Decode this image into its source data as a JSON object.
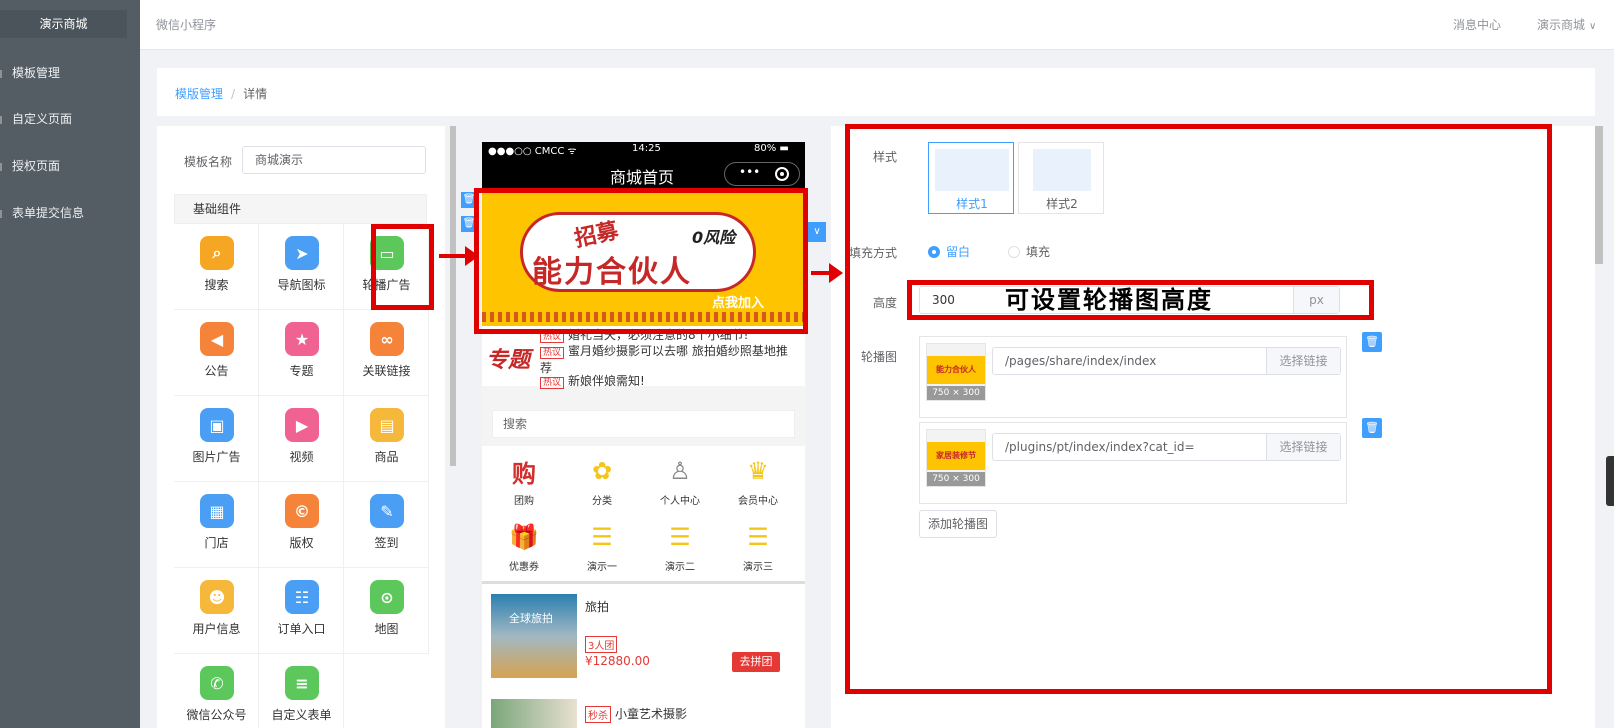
{
  "sidebar": {
    "brand": "演示商城",
    "items": [
      {
        "label": "模板管理"
      },
      {
        "label": "自定义页面"
      },
      {
        "label": "授权页面"
      },
      {
        "label": "表单提交信息"
      }
    ]
  },
  "header": {
    "title": "微信小程序",
    "message_center": "消息中心",
    "user": "演示商城"
  },
  "breadcrumb": {
    "root": "模版管理",
    "separator": "/",
    "current": "详情"
  },
  "template": {
    "name_label": "模板名称",
    "name_value": "商城演示"
  },
  "components": {
    "header": "基础组件",
    "items": [
      {
        "label": "搜索",
        "icon": "search-icon",
        "color": "#f5a623"
      },
      {
        "label": "导航图标",
        "icon": "navigation-icon",
        "color": "#4a9ff5"
      },
      {
        "label": "轮播广告",
        "icon": "carousel-icon",
        "color": "#5cc85c"
      },
      {
        "label": "公告",
        "icon": "megaphone-icon",
        "color": "#f5843a"
      },
      {
        "label": "专题",
        "icon": "topic-icon",
        "color": "#f06292"
      },
      {
        "label": "关联链接",
        "icon": "link-icon",
        "color": "#f5843a"
      },
      {
        "label": "图片广告",
        "icon": "image-icon",
        "color": "#4a9ff5"
      },
      {
        "label": "视频",
        "icon": "video-icon",
        "color": "#f06292"
      },
      {
        "label": "商品",
        "icon": "shopping-bag-icon",
        "color": "#f5b83a"
      },
      {
        "label": "门店",
        "icon": "store-icon",
        "color": "#4a9ff5"
      },
      {
        "label": "版权",
        "icon": "copyright-icon",
        "color": "#f5843a"
      },
      {
        "label": "签到",
        "icon": "pencil-icon",
        "color": "#4a9ff5"
      },
      {
        "label": "用户信息",
        "icon": "user-info-icon",
        "color": "#f5b83a"
      },
      {
        "label": "订单入口",
        "icon": "order-icon",
        "color": "#4a9ff5"
      },
      {
        "label": "地图",
        "icon": "map-pin-icon",
        "color": "#5cc85c"
      },
      {
        "label": "微信公众号",
        "icon": "wechat-icon",
        "color": "#5cc85c"
      },
      {
        "label": "自定义表单",
        "icon": "form-icon",
        "color": "#5cc85c"
      }
    ]
  },
  "preview": {
    "status": {
      "carrier": "●●●○○ CMCC ᯤ",
      "time": "14:25",
      "battery": "80% ▬"
    },
    "page_title": "商城首页",
    "banner": {
      "recruit": "招募",
      "risk": "0风险",
      "headline": "能力合伙人",
      "cta": "点我加入"
    },
    "topic": {
      "logo": "专题",
      "tag": "热议",
      "rows": [
        "婚礼当天，必须注意的8个小细节!",
        "蜜月婚纱摄影可以去哪 旅拍婚纱照基地推荐",
        "新娘伴娘需知!"
      ]
    },
    "search_placeholder": "搜索",
    "nav_icons": [
      {
        "label": "团购",
        "icon": "group-buy-icon",
        "glyph": "购",
        "color": "#d32f2f"
      },
      {
        "label": "分类",
        "icon": "category-icon",
        "glyph": "✿",
        "color": "#f5c518"
      },
      {
        "label": "个人中心",
        "icon": "user-icon",
        "glyph": "♙",
        "color": "#888888"
      },
      {
        "label": "会员中心",
        "icon": "crown-icon",
        "glyph": "♛",
        "color": "#f5c518"
      },
      {
        "label": "优惠券",
        "icon": "gift-icon",
        "glyph": "🎁",
        "color": "#f5c518"
      },
      {
        "label": "演示一",
        "icon": "list-icon",
        "glyph": "☰",
        "color": "#f5c518"
      },
      {
        "label": "演示二",
        "icon": "list-icon",
        "glyph": "☰",
        "color": "#f5c518"
      },
      {
        "label": "演示三",
        "icon": "list-icon",
        "glyph": "☰",
        "color": "#f5c518"
      }
    ],
    "product": {
      "image_text": "全球旅拍",
      "name": "旅拍",
      "tag": "3人团",
      "price": "¥12880.00",
      "button": "去拼团"
    },
    "product2": {
      "tag": "秒杀",
      "name": "小童艺术摄影"
    }
  },
  "settings": {
    "style_label": "样式",
    "styles": [
      "样式1",
      "样式2"
    ],
    "fill_label": "填充方式",
    "fill_options": [
      "留白",
      "填充"
    ],
    "height_label": "高度",
    "height_value": "300",
    "height_unit": "px",
    "height_annotation": "可设置轮播图高度",
    "carousel_label": "轮播图",
    "slides": [
      {
        "image_text": "能力合伙人",
        "size": "750 × 300",
        "link": "/pages/share/index/index",
        "pick": "选择链接"
      },
      {
        "image_text": "家居装修节",
        "size": "750 × 300",
        "link": "/plugins/pt/index/index?cat_id=",
        "pick": "选择链接"
      }
    ],
    "add_button": "添加轮播图"
  },
  "colors": {
    "accent": "#409eff",
    "annotation_red": "#e00000",
    "sidebar_bg": "#545c64"
  }
}
